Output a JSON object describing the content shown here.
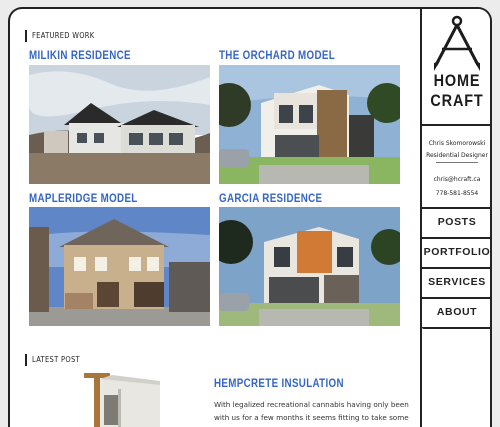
{
  "featured": {
    "heading": "FEATURED WORK",
    "projects": [
      {
        "title": "MILIKIN RESIDENCE"
      },
      {
        "title": "THE ORCHARD MODEL"
      },
      {
        "title": "MAPLERIDGE MODEL"
      },
      {
        "title": "GARCIA RESIDENCE"
      }
    ]
  },
  "logo": {
    "line1": "HOME",
    "line2": "CRAFT"
  },
  "contact": {
    "name": "Chris Skomorowski",
    "role": "Residential Designer",
    "email": "chris@hcraft.ca",
    "phone": "778-581-8554"
  },
  "nav": {
    "items": [
      {
        "label": "POSTS"
      },
      {
        "label": "PORTFOLIO"
      },
      {
        "label": "SERVICES"
      },
      {
        "label": "ABOUT"
      }
    ]
  },
  "latest": {
    "heading": "LATEST POST",
    "title": "HEMPCRETE INSULATION",
    "excerpt": "With legalized recreational cannabis having only been with us for a few months it seems fitting to take some"
  },
  "colors": {
    "accent": "#3566c6",
    "border": "#222222"
  }
}
